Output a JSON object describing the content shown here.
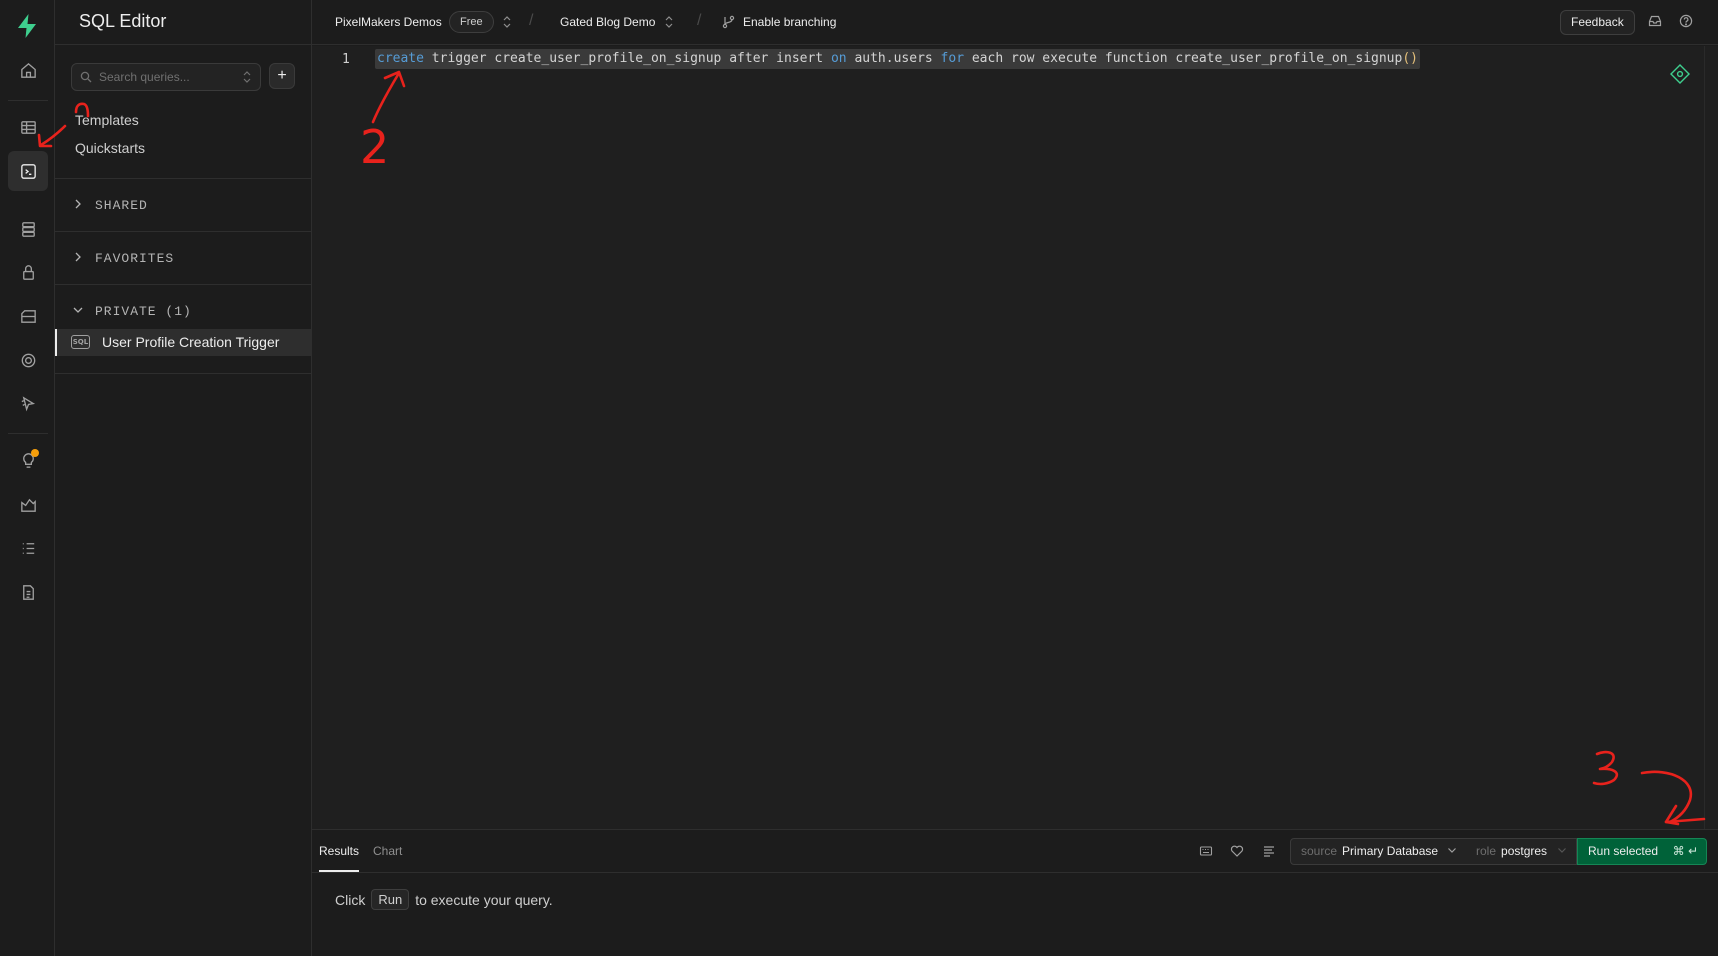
{
  "sidebar": {
    "title": "SQL Editor",
    "search_placeholder": "Search queries...",
    "links": [
      "Templates",
      "Quickstarts"
    ],
    "sections": [
      "SHARED",
      "FAVORITES",
      "PRIVATE (1)"
    ],
    "private_items": [
      {
        "badge": "SQL",
        "label": "User Profile Creation Trigger"
      }
    ]
  },
  "topbar": {
    "org": "PixelMakers Demos",
    "plan": "Free",
    "project": "Gated Blog Demo",
    "branching": "Enable branching",
    "feedback": "Feedback"
  },
  "editor": {
    "line_number": "1",
    "code": {
      "t1": "create",
      "t2": " trigger create_user_profile_on_signup after insert ",
      "t3": "on",
      "t4": " auth.users ",
      "t5": "for",
      "t6": " each row execute function create_user_profile_on_signup",
      "t7": "()"
    }
  },
  "results": {
    "tabs": [
      "Results",
      "Chart"
    ],
    "source_prefix": "source",
    "source_value": "Primary Database",
    "role_prefix": "role",
    "role_value": "postgres",
    "run_label": "Run selected",
    "run_shortcut": "⌘ ↵",
    "hint_before": "Click",
    "hint_key": "Run",
    "hint_after": "to execute your query."
  },
  "annotations": [
    "2",
    "3"
  ],
  "colors": {
    "brand": "#3ecf8e",
    "run_button": "#006239",
    "keyword": "#569cd6",
    "annotation": "#e8221c"
  }
}
